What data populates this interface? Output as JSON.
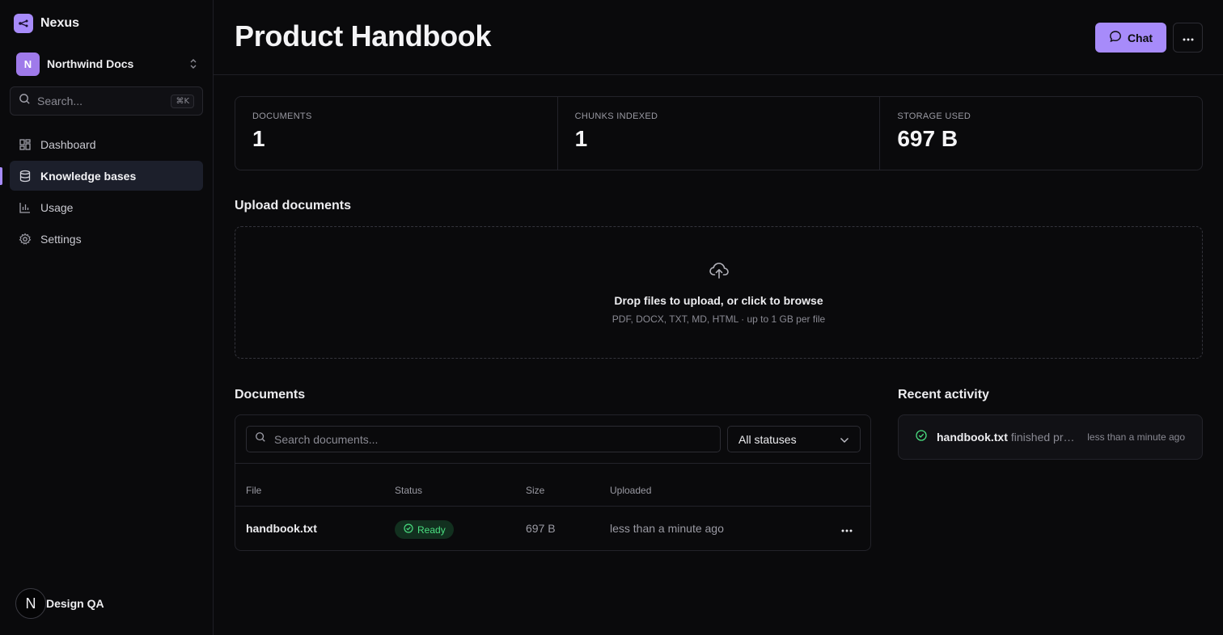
{
  "sidebar": {
    "brand": "Nexus",
    "workspace": {
      "initial": "N",
      "name": "Northwind Docs"
    },
    "search": {
      "placeholder": "Search...",
      "shortcut": "⌘K"
    },
    "items": [
      {
        "label": "Dashboard",
        "icon": "grid-icon"
      },
      {
        "label": "Knowledge bases",
        "icon": "database-icon",
        "active": true
      },
      {
        "label": "Usage",
        "icon": "bar-chart-icon"
      },
      {
        "label": "Settings",
        "icon": "gear-icon"
      }
    ],
    "user": {
      "initial": "N",
      "name": "Design QA"
    }
  },
  "header": {
    "title": "Product Handbook",
    "chat_label": "Chat"
  },
  "stats": [
    {
      "label": "DOCUMENTS",
      "value": "1"
    },
    {
      "label": "CHUNKS INDEXED",
      "value": "1"
    },
    {
      "label": "STORAGE USED",
      "value": "697 B"
    }
  ],
  "upload": {
    "title": "Upload documents",
    "main_text": "Drop files to upload, or click to browse",
    "sub_text": "PDF, DOCX, TXT, MD, HTML · up to 1 GB per file"
  },
  "documents": {
    "title": "Documents",
    "search_placeholder": "Search documents...",
    "status_filter": "All statuses",
    "columns": [
      "File",
      "Status",
      "Size",
      "Uploaded"
    ],
    "rows": [
      {
        "file": "handbook.txt",
        "status": "Ready",
        "size": "697 B",
        "uploaded": "less than a minute ago"
      }
    ]
  },
  "activity": {
    "title": "Recent activity",
    "items": [
      {
        "file": "handbook.txt",
        "text": "finished processing",
        "time": "less than a minute ago"
      }
    ]
  },
  "colors": {
    "accent": "#a78bfa",
    "background": "#0a0a0c",
    "success": "#4ade80"
  }
}
